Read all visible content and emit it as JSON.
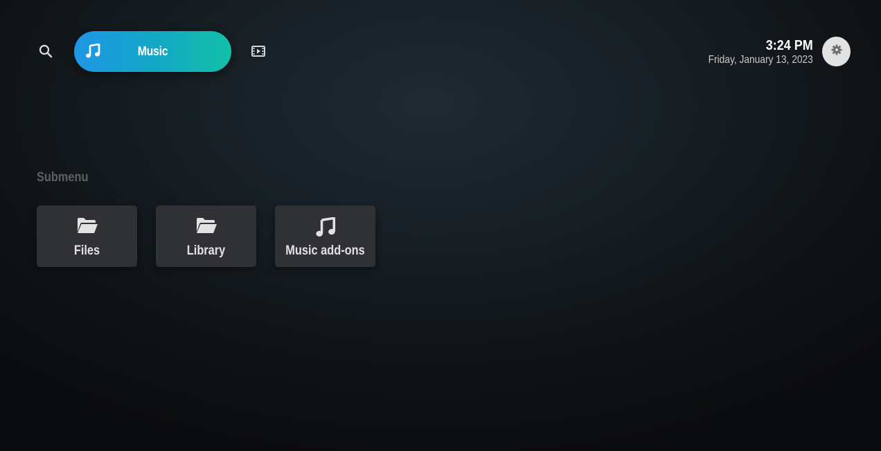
{
  "topbar": {
    "search": {
      "icon": "search-icon"
    },
    "active_section": {
      "label": "Music",
      "icon": "music-note-icon",
      "gradient": [
        "#1f96e6",
        "#12c0a6"
      ]
    },
    "next_section": {
      "icon": "video-icon"
    },
    "clock": {
      "time": "3:24 PM",
      "date": "Friday, January 13, 2023"
    },
    "settings": {
      "icon": "gear-icon"
    }
  },
  "submenu": {
    "title": "Submenu",
    "items": [
      {
        "label": "Files",
        "icon": "folder-open-icon"
      },
      {
        "label": "Library",
        "icon": "folder-open-icon"
      },
      {
        "label": "Music add-ons",
        "icon": "music-note-icon"
      }
    ]
  },
  "colors": {
    "tile_bg": "#2f3134",
    "text": "#e2e2e2",
    "muted": "#5c6164"
  }
}
